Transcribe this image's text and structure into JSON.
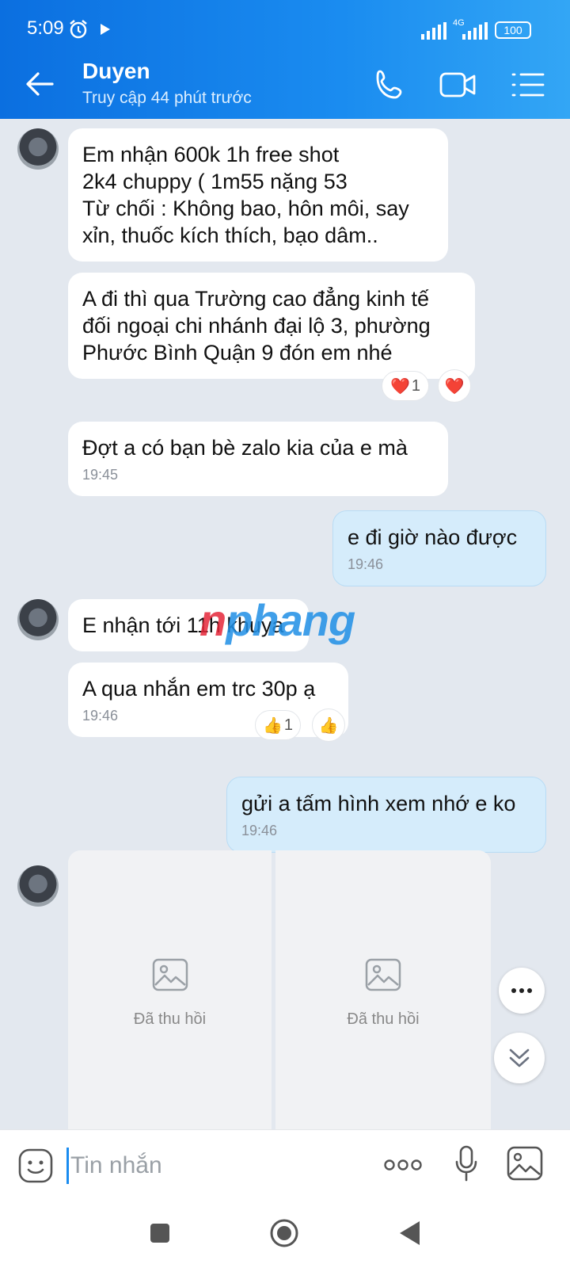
{
  "status": {
    "time": "5:09",
    "network": "4G",
    "battery": "100"
  },
  "header": {
    "name": "Duyen",
    "subtitle": "Truy cập 44 phút trước"
  },
  "messages": [
    {
      "text": "Em nhận 600k 1h free shot\n2k4 chuppy ( 1m55 nặng 53\nTừ chối : Không bao, hôn môi, say xỉn, thuốc kích thích, bạo dâm.."
    },
    {
      "text": "A đi thì qua Trường cao đẳng kinh tế đối ngoại chi nhánh đại lộ 3, phường Phước Bình Quận 9 đón em nhé",
      "reaction": "❤️",
      "reaction_count": "1"
    },
    {
      "text": "Đợt a có bạn bè zalo kia của e mà",
      "time": "19:45"
    },
    {
      "text": "e đi giờ nào được",
      "time": "19:46"
    },
    {
      "text": "E nhận tới 11h khuya"
    },
    {
      "text": "A qua nhắn em trc 30p ạ",
      "time": "19:46",
      "reaction": "👍",
      "reaction_count": "1"
    },
    {
      "text": "gửi a tấm hình xem nhớ e ko",
      "time": "19:46"
    }
  ],
  "recalled": {
    "label": "Đã thu hồi"
  },
  "watermark": {
    "part1": "n",
    "part2": "phang"
  },
  "input": {
    "placeholder": "Tin nhắn"
  },
  "colors": {
    "accent": "#1a8cf0",
    "mine_bubble": "#d5ecfb",
    "background": "#e3e8ef"
  }
}
